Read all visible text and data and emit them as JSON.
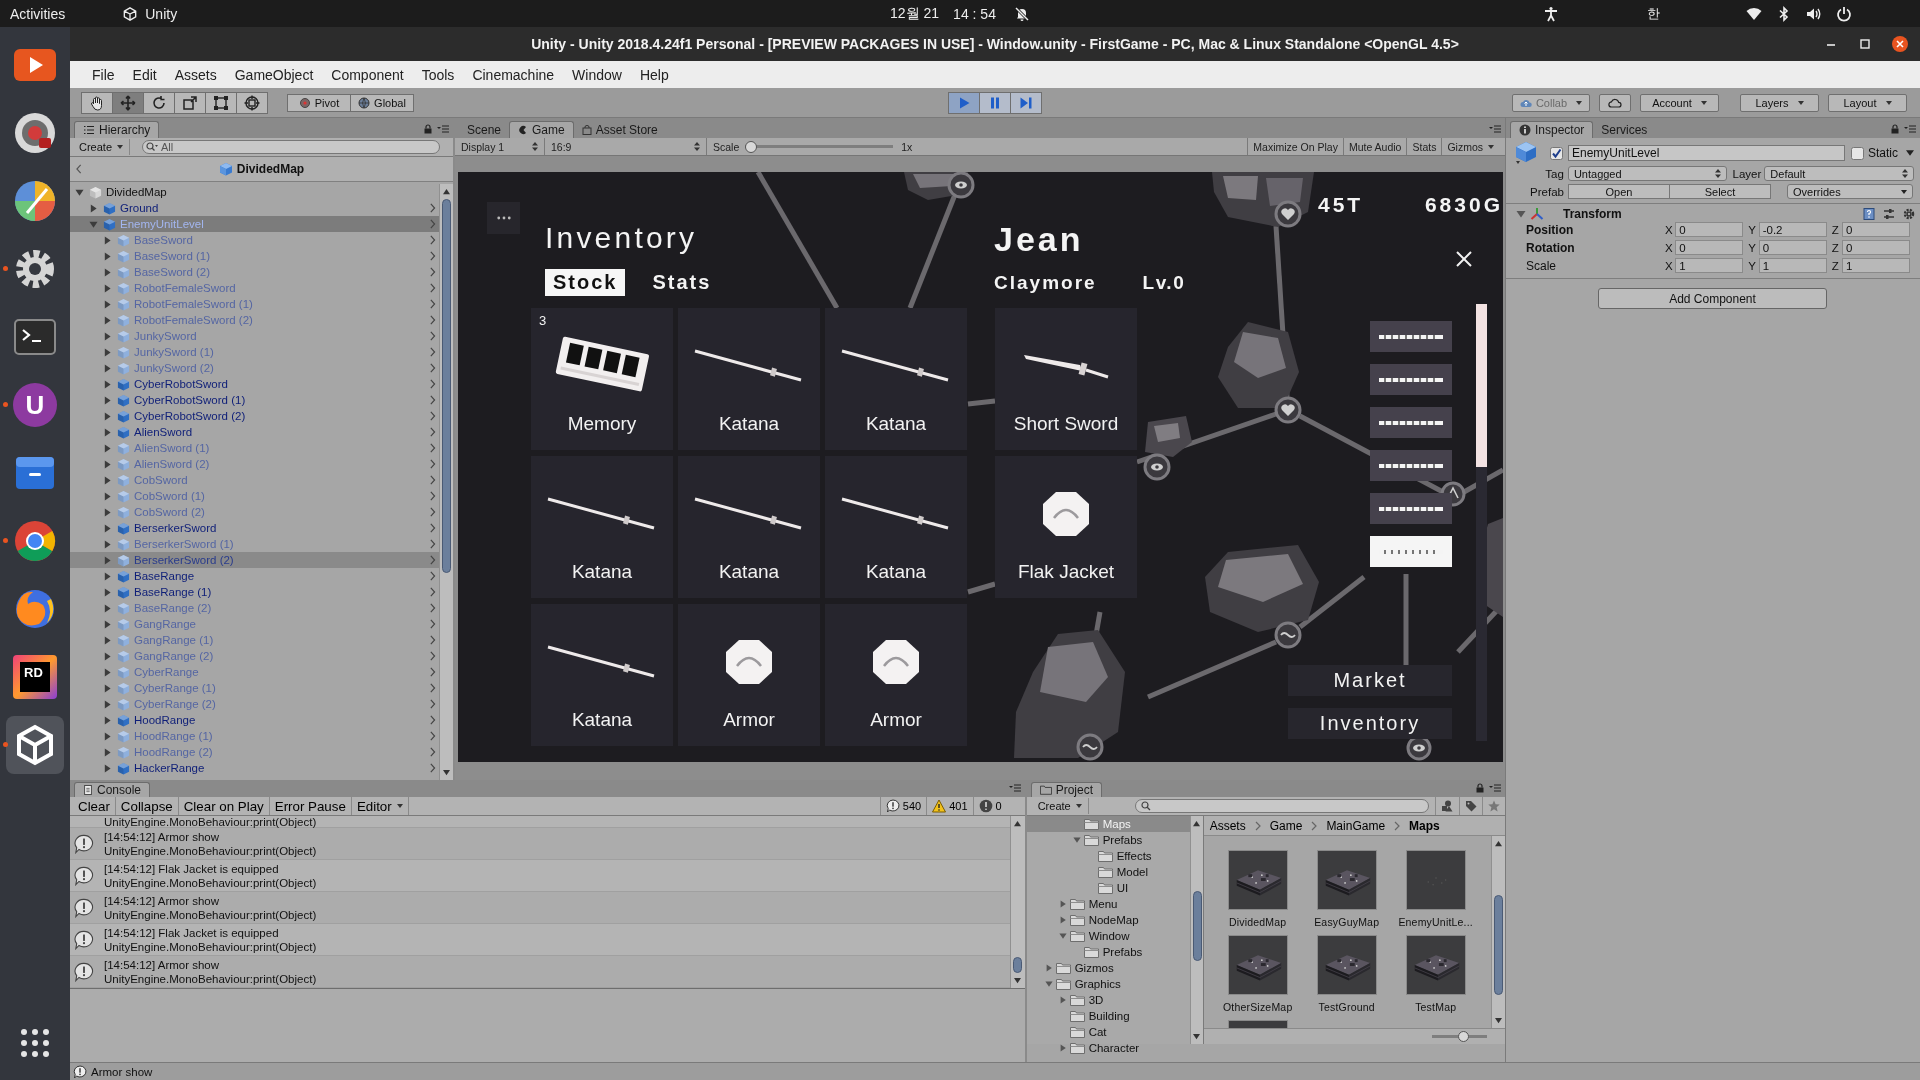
{
  "top_bar": {
    "activities": "Activities",
    "app": "Unity",
    "date": "12월 21",
    "time": "14 : 54",
    "input_method": "한"
  },
  "dock": [
    {
      "kind": "media",
      "running": false,
      "selected": false
    },
    {
      "kind": "camera",
      "running": false,
      "selected": false
    },
    {
      "kind": "pinwheel",
      "running": false,
      "selected": false
    },
    {
      "kind": "settings",
      "running": true,
      "selected": false
    },
    {
      "kind": "terminal",
      "running": false,
      "selected": false
    },
    {
      "kind": "hub",
      "label": "U",
      "running": true,
      "selected": false
    },
    {
      "kind": "files",
      "running": false,
      "selected": false
    },
    {
      "kind": "browser",
      "running": true,
      "selected": false
    },
    {
      "kind": "fox",
      "running": false,
      "selected": false
    },
    {
      "kind": "ide",
      "label": "RD",
      "running": false,
      "selected": false
    },
    {
      "kind": "unity",
      "running": true,
      "selected": true
    }
  ],
  "window": {
    "title": "Unity - Unity 2018.4.24f1 Personal - [PREVIEW PACKAGES IN USE] - Window.unity - FirstGame - PC, Mac & Linux Standalone <OpenGL 4.5>"
  },
  "menu": [
    "File",
    "Edit",
    "Assets",
    "GameObject",
    "Component",
    "Tools",
    "Cinemachine",
    "Window",
    "Help"
  ],
  "toolbar": {
    "tools": [
      {
        "kind": "hand",
        "selected": false
      },
      {
        "kind": "move",
        "selected": true
      },
      {
        "kind": "rotate",
        "selected": false
      },
      {
        "kind": "scale",
        "selected": false
      },
      {
        "kind": "rect",
        "selected": false
      },
      {
        "kind": "transform",
        "selected": false
      }
    ],
    "pivot": "Pivot",
    "space": "Global",
    "playback": [
      {
        "kind": "play",
        "on": true
      },
      {
        "kind": "pause",
        "on": false
      },
      {
        "kind": "step",
        "on": false
      }
    ],
    "collab": {
      "label": "Collab",
      "disabled": true
    },
    "account": "Account",
    "layers": "Layers",
    "layout": "Layout"
  },
  "hierarchy": {
    "tab": "Hierarchy",
    "create": "Create",
    "search": {
      "placeholder": "All"
    },
    "scene": "DividedMap",
    "items": [
      {
        "name": "DividedMap",
        "kind": "scene",
        "active": true,
        "selected": false,
        "hovered": false,
        "expanded": true,
        "children": [
          {
            "name": "Ground",
            "kind": "prefab",
            "active": true,
            "selected": false,
            "hovered": false,
            "expanded": false
          },
          {
            "name": "EnemyUnitLevel",
            "kind": "prefab",
            "active": true,
            "selected": true,
            "hovered": false,
            "expanded": true,
            "children": [
              {
                "name": "BaseSword",
                "kind": "prefab",
                "active": false,
                "selected": false,
                "hovered": false,
                "expanded": false
              },
              {
                "name": "BaseSword (1)",
                "kind": "prefab",
                "active": false,
                "selected": false,
                "hovered": false,
                "expanded": false
              },
              {
                "name": "BaseSword (2)",
                "kind": "prefab",
                "active": false,
                "selected": false,
                "hovered": false,
                "expanded": false
              },
              {
                "name": "RobotFemaleSword",
                "kind": "prefab",
                "active": false,
                "selected": false,
                "hovered": false,
                "expanded": false
              },
              {
                "name": "RobotFemaleSword (1)",
                "kind": "prefab",
                "active": false,
                "selected": false,
                "hovered": false,
                "expanded": false
              },
              {
                "name": "RobotFemaleSword (2)",
                "kind": "prefab",
                "active": false,
                "selected": false,
                "hovered": false,
                "expanded": false
              },
              {
                "name": "JunkySword",
                "kind": "prefab",
                "active": false,
                "selected": false,
                "hovered": false,
                "expanded": false
              },
              {
                "name": "JunkySword (1)",
                "kind": "prefab",
                "active": false,
                "selected": false,
                "hovered": false,
                "expanded": false
              },
              {
                "name": "JunkySword (2)",
                "kind": "prefab",
                "active": false,
                "selected": false,
                "hovered": false,
                "expanded": false
              },
              {
                "name": "CyberRobotSword",
                "kind": "prefab",
                "active": true,
                "selected": false,
                "hovered": false,
                "expanded": false
              },
              {
                "name": "CyberRobotSword (1)",
                "kind": "prefab",
                "active": true,
                "selected": false,
                "hovered": false,
                "expanded": false
              },
              {
                "name": "CyberRobotSword (2)",
                "kind": "prefab",
                "active": true,
                "selected": false,
                "hovered": false,
                "expanded": false
              },
              {
                "name": "AlienSword",
                "kind": "prefab",
                "active": true,
                "selected": false,
                "hovered": false,
                "expanded": false
              },
              {
                "name": "AlienSword (1)",
                "kind": "prefab",
                "active": false,
                "selected": false,
                "hovered": false,
                "expanded": false
              },
              {
                "name": "AlienSword (2)",
                "kind": "prefab",
                "active": false,
                "selected": false,
                "hovered": false,
                "expanded": false
              },
              {
                "name": "CobSword",
                "kind": "prefab",
                "active": false,
                "selected": false,
                "hovered": false,
                "expanded": false
              },
              {
                "name": "CobSword (1)",
                "kind": "prefab",
                "active": false,
                "selected": false,
                "hovered": false,
                "expanded": false
              },
              {
                "name": "CobSword (2)",
                "kind": "prefab",
                "active": false,
                "selected": false,
                "hovered": false,
                "expanded": false
              },
              {
                "name": "BerserkerSword",
                "kind": "prefab",
                "active": true,
                "selected": false,
                "hovered": false,
                "expanded": false
              },
              {
                "name": "BerserkerSword (1)",
                "kind": "prefab",
                "active": false,
                "selected": false,
                "hovered": false,
                "expanded": false
              },
              {
                "name": "BerserkerSword (2)",
                "kind": "prefab",
                "active": false,
                "selected": false,
                "hovered": true,
                "expanded": false
              },
              {
                "name": "BaseRange",
                "kind": "prefab",
                "active": true,
                "selected": false,
                "hovered": false,
                "expanded": false
              },
              {
                "name": "BaseRange (1)",
                "kind": "prefab",
                "active": true,
                "selected": false,
                "hovered": false,
                "expanded": false
              },
              {
                "name": "BaseRange (2)",
                "kind": "prefab",
                "active": false,
                "selected": false,
                "hovered": false,
                "expanded": false
              },
              {
                "name": "GangRange",
                "kind": "prefab",
                "active": false,
                "selected": false,
                "hovered": false,
                "expanded": false
              },
              {
                "name": "GangRange (1)",
                "kind": "prefab",
                "active": false,
                "selected": false,
                "hovered": false,
                "expanded": false
              },
              {
                "name": "GangRange (2)",
                "kind": "prefab",
                "active": false,
                "selected": false,
                "hovered": false,
                "expanded": false
              },
              {
                "name": "CyberRange",
                "kind": "prefab",
                "active": false,
                "selected": false,
                "hovered": false,
                "expanded": false
              },
              {
                "name": "CyberRange (1)",
                "kind": "prefab",
                "active": false,
                "selected": false,
                "hovered": false,
                "expanded": false
              },
              {
                "name": "CyberRange (2)",
                "kind": "prefab",
                "active": false,
                "selected": false,
                "hovered": false,
                "expanded": false
              },
              {
                "name": "HoodRange",
                "kind": "prefab",
                "active": true,
                "selected": false,
                "hovered": false,
                "expanded": false
              },
              {
                "name": "HoodRange (1)",
                "kind": "prefab",
                "active": false,
                "selected": false,
                "hovered": false,
                "expanded": false
              },
              {
                "name": "HoodRange (2)",
                "kind": "prefab",
                "active": false,
                "selected": false,
                "hovered": false,
                "expanded": false
              },
              {
                "name": "HackerRange",
                "kind": "prefab",
                "active": true,
                "selected": false,
                "hovered": false,
                "expanded": false
              }
            ]
          }
        ]
      }
    ]
  },
  "scene_tabs": [
    {
      "label": "Scene",
      "kind": "scene",
      "selected": false
    },
    {
      "label": "Game",
      "kind": "game",
      "selected": true
    },
    {
      "label": "Asset Store",
      "kind": "store",
      "selected": false
    }
  ],
  "game_toolbar": {
    "display": "Display 1",
    "aspect": "16:9",
    "scale_label": "Scale",
    "scale": {
      "level": 0
    },
    "scale_value": "1x",
    "buttons": [
      "Maximize On Play",
      "Mute Audio",
      "Stats"
    ],
    "gizmos": "Gizmos"
  },
  "game": {
    "turns": "45T",
    "gold": "6830G",
    "inventory": {
      "title": "Inventory",
      "tabs": [
        {
          "label": "Stock",
          "selected": true
        },
        {
          "label": "Stats",
          "selected": false
        }
      ],
      "items": [
        {
          "name": "Memory",
          "kind": "memory",
          "count": "3"
        },
        {
          "name": "Katana",
          "kind": "katana"
        },
        {
          "name": "Katana",
          "kind": "katana"
        },
        {
          "name": "Katana",
          "kind": "katana"
        },
        {
          "name": "Katana",
          "kind": "katana"
        },
        {
          "name": "Katana",
          "kind": "katana"
        },
        {
          "name": "Katana",
          "kind": "katana"
        },
        {
          "name": "Armor",
          "kind": "armor"
        },
        {
          "name": "Armor",
          "kind": "armor"
        }
      ]
    },
    "character": {
      "name": "Jean",
      "class": "Claymore",
      "level": "Lv.0",
      "equipment": [
        {
          "name": "Short Sword",
          "kind": "short-sword"
        },
        {
          "name": "Flak Jacket",
          "kind": "armor"
        }
      ]
    },
    "party": [
      {
        "selected": false
      },
      {
        "selected": false
      },
      {
        "selected": false
      },
      {
        "selected": false
      },
      {
        "selected": false
      },
      {
        "selected": true
      }
    ],
    "buttons": [
      "Market",
      "Inventory"
    ]
  },
  "inspector": {
    "tabs": [
      {
        "label": "Inspector",
        "selected": true
      },
      {
        "label": "Services",
        "selected": false
      }
    ],
    "object": {
      "enabled": true,
      "name": "EnemyUnitLevel",
      "static": false,
      "static_label": "Static",
      "tag_label": "Tag",
      "tag": "Untagged",
      "layer_label": "Layer",
      "layer": "Default",
      "prefab_label": "Prefab",
      "prefab_buttons": [
        "Open",
        "Select"
      ],
      "overrides": "Overrides"
    },
    "transform": {
      "title": "Transform",
      "expanded": true,
      "rows": [
        {
          "label": "Position",
          "overridden": true,
          "axes": [
            {
              "axis": "X",
              "value": "0"
            },
            {
              "axis": "Y",
              "value": "-0.2"
            },
            {
              "axis": "Z",
              "value": "0"
            }
          ]
        },
        {
          "label": "Rotation",
          "overridden": true,
          "axes": [
            {
              "axis": "X",
              "value": "0"
            },
            {
              "axis": "Y",
              "value": "0"
            },
            {
              "axis": "Z",
              "value": "0"
            }
          ]
        },
        {
          "label": "Scale",
          "overridden": false,
          "axes": [
            {
              "axis": "X",
              "value": "1"
            },
            {
              "axis": "Y",
              "value": "1"
            },
            {
              "axis": "Z",
              "value": "1"
            }
          ]
        }
      ]
    },
    "add_component": "Add Component"
  },
  "console": {
    "tab": "Console",
    "buttons": [
      "Clear",
      "Collapse",
      "Clear on Play",
      "Error Pause"
    ],
    "editor": "Editor",
    "counts": [
      {
        "kind": "info",
        "value": "540"
      },
      {
        "kind": "warning",
        "value": "401"
      },
      {
        "kind": "error",
        "value": "0"
      }
    ],
    "entries": [
      {
        "trace": "UnityEngine.MonoBehaviour:print(Object)"
      },
      {
        "message": "[14:54:12] Armor show",
        "trace": "UnityEngine.MonoBehaviour:print(Object)"
      },
      {
        "message": "[14:54:12] Flak Jacket is equipped",
        "trace": "UnityEngine.MonoBehaviour:print(Object)"
      },
      {
        "message": "[14:54:12] Armor show",
        "trace": "UnityEngine.MonoBehaviour:print(Object)"
      },
      {
        "message": "[14:54:12] Flak Jacket is equipped",
        "trace": "UnityEngine.MonoBehaviour:print(Object)"
      },
      {
        "message": "[14:54:12] Armor show",
        "trace": "UnityEngine.MonoBehaviour:print(Object)"
      }
    ]
  },
  "project": {
    "tab": "Project",
    "create": "Create",
    "tree": [
      {
        "children": [
          {
            "children": [
              {
                "name": "Maps",
                "selected": true
              },
              {
                "name": "Prefabs",
                "expanded": true,
                "selected": false,
                "children": [
                  {
                    "name": "Effects",
                    "selected": false
                  },
                  {
                    "name": "Model",
                    "selected": false
                  },
                  {
                    "name": "UI",
                    "selected": false
                  }
                ]
              }
            ]
          },
          {
            "name": "Menu",
            "expanded": false,
            "selected": false
          },
          {
            "name": "NodeMap",
            "expanded": false,
            "selected": false
          },
          {
            "name": "Window",
            "expanded": true,
            "selected": false,
            "children": [
              {
                "name": "Prefabs",
                "selected": false
              }
            ]
          }
        ]
      },
      {
        "name": "Gizmos",
        "expanded": false,
        "selected": false
      },
      {
        "name": "Graphics",
        "expanded": true,
        "selected": false,
        "children": [
          {
            "name": "3D",
            "expanded": false,
            "selected": false
          },
          {
            "name": "Building",
            "selected": false
          },
          {
            "name": "Cat",
            "selected": false
          },
          {
            "name": "Character",
            "expanded": false,
            "selected": false
          }
        ]
      }
    ],
    "breadcrumb": [
      "Assets",
      "Game",
      "MainGame",
      "Maps"
    ],
    "assets": [
      {
        "name": "DividedMap",
        "kind": "board"
      },
      {
        "name": "EasyGuyMap",
        "kind": "board"
      },
      {
        "name": "EnemyUnitLe...",
        "kind": "sparse"
      },
      {
        "name": "OtherSizeMap",
        "kind": "board"
      },
      {
        "name": "TestGround",
        "kind": "board"
      },
      {
        "name": "TestMap",
        "kind": "board"
      },
      {
        "kind": "board"
      }
    ],
    "icon_size": {
      "level": 0.6
    }
  },
  "status_bar": {
    "message": "Armor show"
  }
}
